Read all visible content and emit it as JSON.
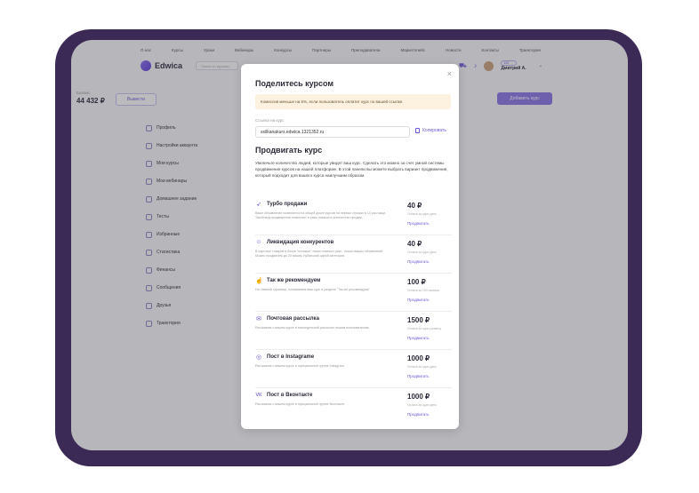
{
  "top_nav": [
    "О нас",
    "Курсы",
    "Уроки",
    "Вебинары",
    "Конкурсы",
    "Партнеры",
    "Преподаватели",
    "Маркетплейс",
    "Новости",
    "Контакты",
    "Траектория"
  ],
  "header": {
    "logo": "Edwica",
    "search_placeholder": "Поиск по курсам...",
    "user_badge": "120",
    "user_name": "Дмитрий А."
  },
  "balance": {
    "label": "Баланс",
    "value": "44 432 ₽",
    "withdraw": "Вывести"
  },
  "add_course": "Добавить курс",
  "sidebar": [
    "Профиль",
    "Настройки аккаунта",
    "Мои курсы",
    "Мои вебинары",
    "Домашнее задание",
    "Тесты",
    "Избранные",
    "Статистика",
    "Финансы",
    "Сообщения",
    "Друзья",
    "Траектория"
  ],
  "modal": {
    "title": "Поделитесь курсом",
    "close": "×",
    "note": "Комиссия меньше на 5%, если пользователь оплатит курс по вашей ссылке.",
    "link_label": "Ссылка на курс",
    "link_value": "ssilkanakurs.edwica.1321352.ru",
    "copy": "Копировать",
    "promo_title": "Продвигать курс",
    "promo_desc": "Увеличьте количество людей, которые увидят ваш курс. Сделать это можно за счет умной системы продвижения курсов на нашей платформе. В этой панели вы можете выбрать вариант продвижения, который подходит для вашего курса наилучшим образом.",
    "services": [
      {
        "icon": "rocket-icon",
        "name": "Турбо продажи",
        "desc": "Ваше объявление появляется на общей доске курсов на первых строках в 10 раз чаще. Такой вид продвижения позволяет в разы повысить количество продаж.",
        "price": "40 ₽",
        "term": "Оплата за один день",
        "action": "Продвигать"
      },
      {
        "icon": "users-icon",
        "name": "Ликвидация конкурентов",
        "desc": "В карточке товаров в блоке \"похожие\" показ платных рекл. только ваших объявлений. Можно продвигать до 20 вашек, Кубанский одной категории.",
        "price": "40 ₽",
        "term": "Оплата за один день",
        "action": "Продвигать"
      },
      {
        "icon": "thumbs-up-icon",
        "name": "Так же рекомендуем",
        "desc": "На главной странице, показываем ваш курс в разделе \"Так же рекомендуем\".",
        "price": "100 ₽",
        "term": "Оплата за 100 показов",
        "action": "Продвигать"
      },
      {
        "icon": "mail-icon",
        "name": "Почтовая рассылка",
        "desc": "Расскажем о вашем курсе в еженедельной рассылке нашим пользователям.",
        "price": "1500 ₽",
        "term": "Оплата за одно размещ.",
        "action": "Продвигать"
      },
      {
        "icon": "instagram-icon",
        "name": "Пост в Instagrame",
        "desc": "Расскажем о вашем курсе в официальной группе Instagram.",
        "price": "1000 ₽",
        "term": "Оплата за один день",
        "action": "Продвигать"
      },
      {
        "icon": "vk-icon",
        "name": "Пост в Вконтакте",
        "desc": "Расскажем о вашем курсе в официальной группе Вконтакте.",
        "price": "1000 ₽",
        "term": "Оплата за один день",
        "action": "Продвигать"
      }
    ]
  }
}
